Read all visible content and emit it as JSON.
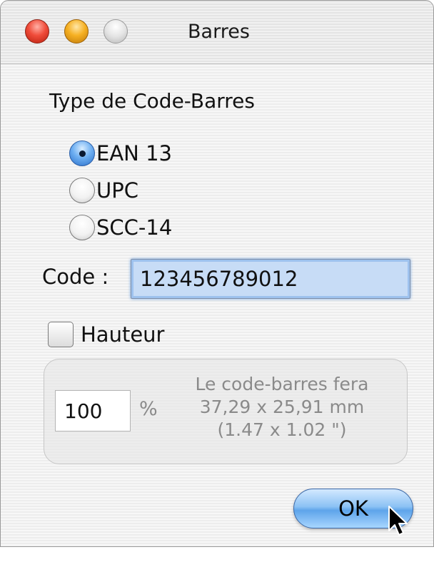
{
  "window": {
    "title": "Barres"
  },
  "barcode_type": {
    "label": "Type de Code-Barres",
    "options": [
      {
        "label": "EAN 13",
        "selected": true
      },
      {
        "label": "UPC",
        "selected": false
      },
      {
        "label": "SCC-14",
        "selected": false
      }
    ]
  },
  "code": {
    "label": "Code :",
    "value": "123456789012"
  },
  "height": {
    "checkbox_label": "Hauteur",
    "checked": false,
    "percent_value": "100",
    "percent_unit": "%",
    "result_line1": "Le code-barres fera",
    "result_line2": "37,29 x 25,91 mm",
    "result_line3": "(1.47 x 1.02 \")"
  },
  "buttons": {
    "ok_label": "OK"
  }
}
